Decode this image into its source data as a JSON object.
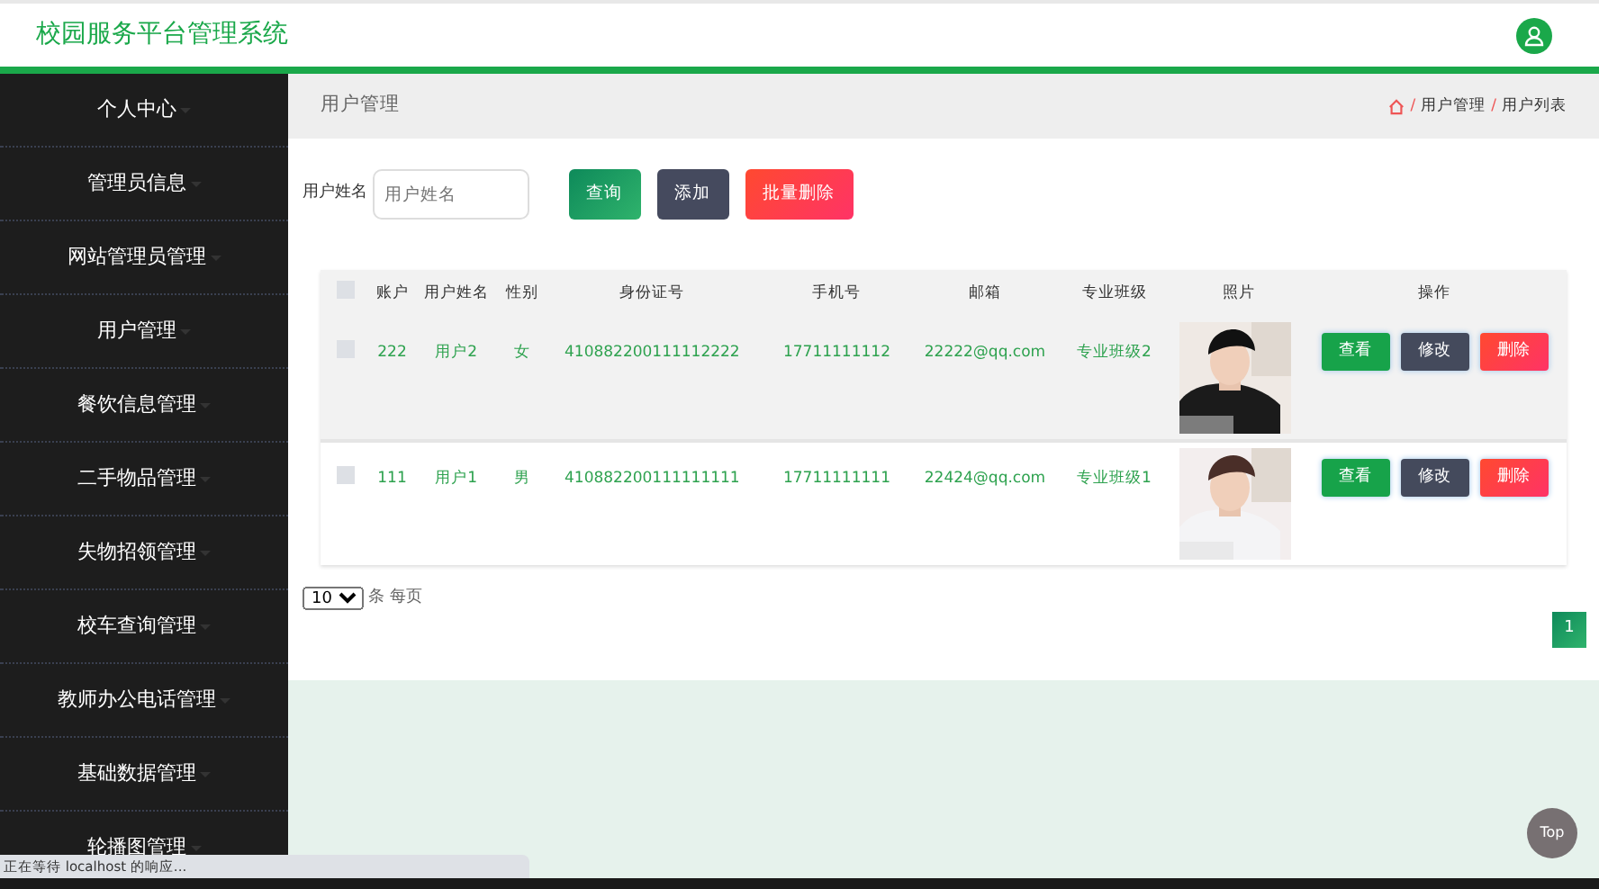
{
  "header": {
    "title": "校园服务平台管理系统"
  },
  "sidebar": {
    "items": [
      {
        "label": "个人中心"
      },
      {
        "label": "管理员信息"
      },
      {
        "label": "网站管理员管理"
      },
      {
        "label": "用户管理"
      },
      {
        "label": "餐饮信息管理"
      },
      {
        "label": "二手物品管理"
      },
      {
        "label": "失物招领管理"
      },
      {
        "label": "校车查询管理"
      },
      {
        "label": "教师办公电话管理"
      },
      {
        "label": "基础数据管理"
      },
      {
        "label": "轮播图管理"
      }
    ]
  },
  "page_title": "用户管理",
  "breadcrumb": [
    {
      "separator": "/",
      "label": "用户管理"
    },
    {
      "separator": "/",
      "label": "用户列表"
    }
  ],
  "search": {
    "label": "用户姓名",
    "placeholder": "用户姓名",
    "buttons": [
      {
        "label": "查询",
        "kind": "query"
      },
      {
        "label": "添加",
        "kind": "add"
      },
      {
        "label": "批量删除",
        "kind": "delete"
      }
    ]
  },
  "table": {
    "select_all_checked": false,
    "columns": [
      "账户",
      "用户姓名",
      "性别",
      "身份证号",
      "手机号",
      "邮箱",
      "专业班级",
      "照片",
      "操作"
    ],
    "rows": [
      {
        "checked": false,
        "cells": [
          "222",
          "用户2",
          "女",
          "410882200111112222",
          "17711111112",
          "22222@qq.com",
          "专业班级2"
        ],
        "actions": [
          {
            "label": "查看",
            "kind": "view"
          },
          {
            "label": "修改",
            "kind": "edit"
          },
          {
            "label": "删除",
            "kind": "delete"
          }
        ]
      },
      {
        "checked": false,
        "cells": [
          "111",
          "用户1",
          "男",
          "410882200111111111",
          "17711111111",
          "22424@qq.com",
          "专业班级1"
        ],
        "actions": [
          {
            "label": "查看",
            "kind": "view"
          },
          {
            "label": "修改",
            "kind": "edit"
          },
          {
            "label": "删除",
            "kind": "delete"
          }
        ]
      }
    ]
  },
  "pagination": {
    "page_size": "10",
    "page_size_label": "条 每页",
    "pages": [
      {
        "label": "1",
        "selected": true
      }
    ]
  },
  "top_button": "Top",
  "status_bar": "正在等待 localhost 的响应..."
}
